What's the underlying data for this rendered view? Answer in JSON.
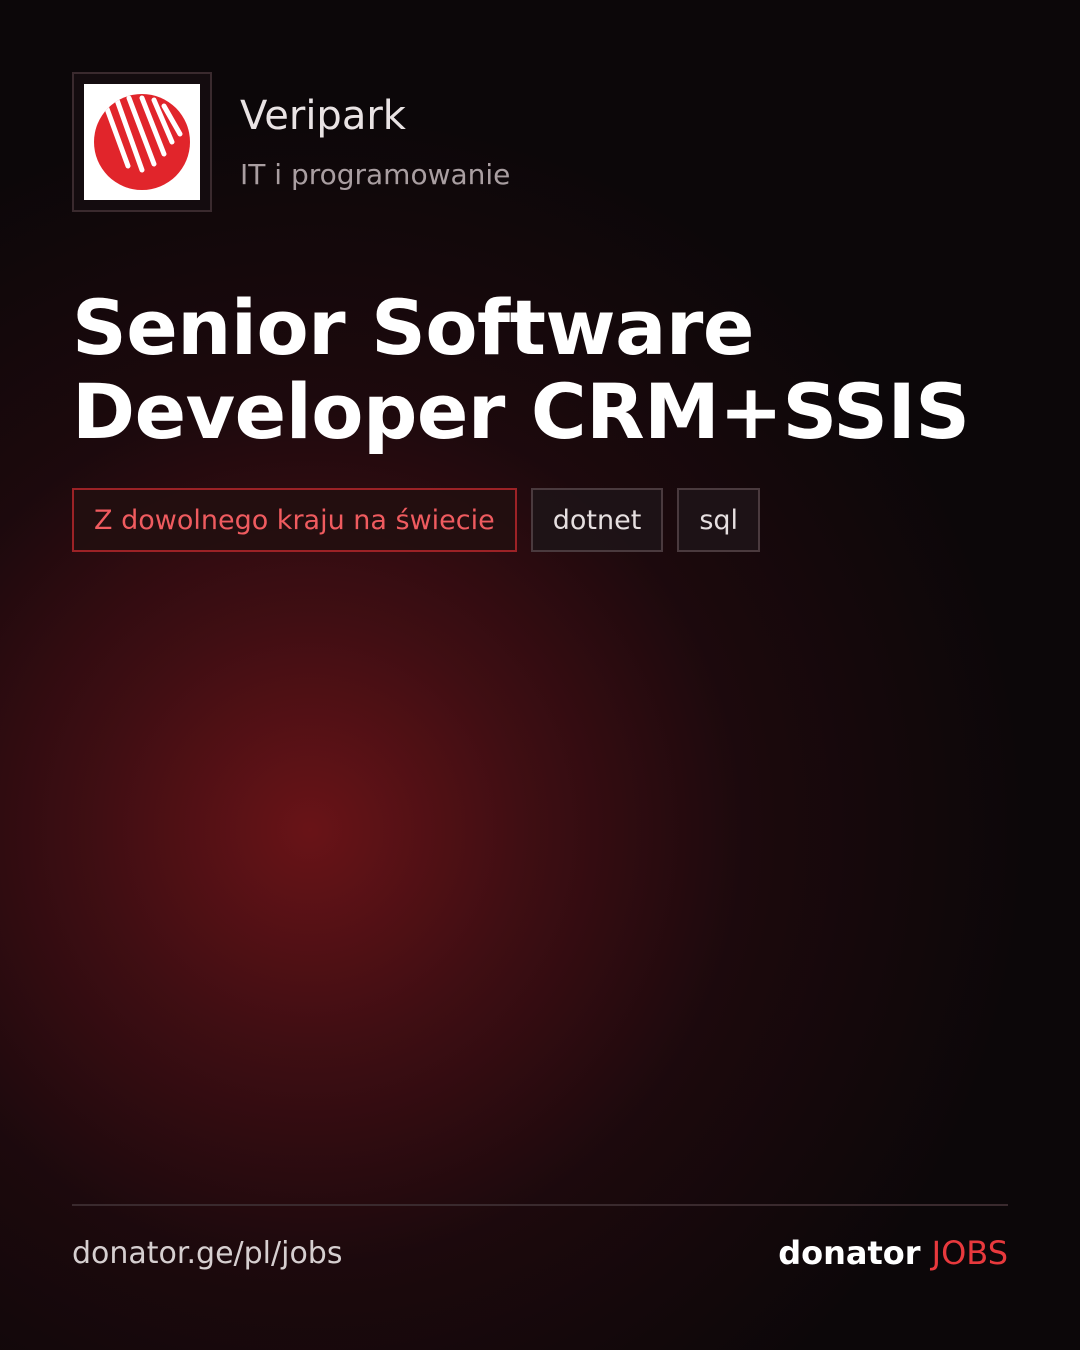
{
  "company": {
    "name": "Veripark",
    "category": "IT i programowanie",
    "logo_icon": "veripark-logo-icon"
  },
  "job": {
    "title": "Senior Software Developer CRM+SSIS"
  },
  "tags": [
    {
      "label": "Z dowolnego kraju na świecie",
      "kind": "location"
    },
    {
      "label": "dotnet",
      "kind": "skill"
    },
    {
      "label": "sql",
      "kind": "skill"
    }
  ],
  "footer": {
    "url": "donator.ge/pl/jobs",
    "brand_main": "donator",
    "brand_accent": "JOBS"
  },
  "colors": {
    "background": "#0c0709",
    "accent": "#e8393d",
    "logo_red": "#e1252b",
    "location_border": "#9c2226"
  }
}
